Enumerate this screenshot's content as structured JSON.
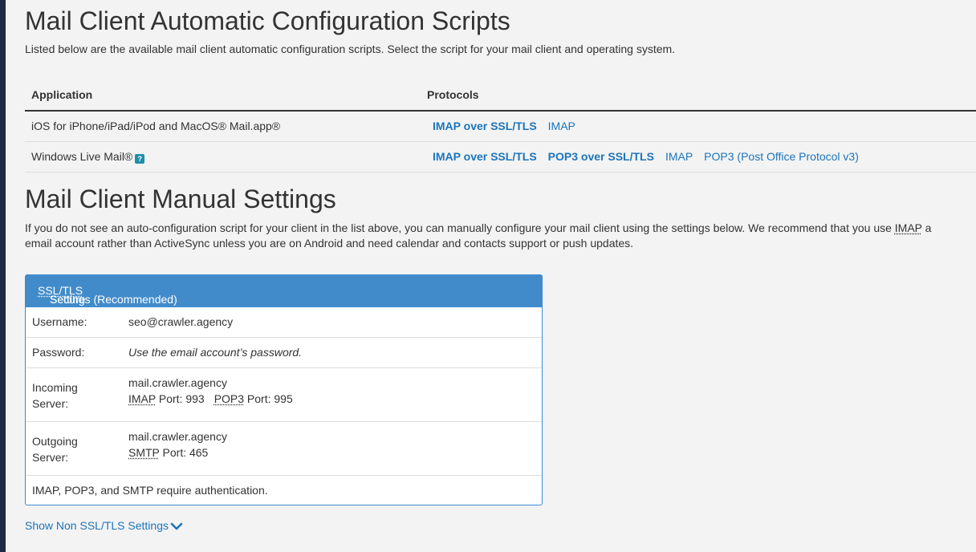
{
  "auto": {
    "title": "Mail Client Automatic Configuration Scripts",
    "intro": "Listed below are the available mail client automatic configuration scripts. Select the script for your mail client and operating system.",
    "columns": {
      "application": "Application",
      "protocols": "Protocols"
    },
    "rows": [
      {
        "app": "iOS for iPhone/iPad/iPod and MacOS® Mail.app®",
        "links": [
          "IMAP over SSL/TLS",
          "IMAP"
        ]
      },
      {
        "app": "Windows Live Mail®",
        "links": [
          "IMAP over SSL/TLS",
          "POP3 over SSL/TLS",
          "IMAP",
          "POP3 (Post Office Protocol v3)"
        ]
      }
    ]
  },
  "manual": {
    "title": "Mail Client Manual Settings",
    "intro_line1_pre": "If you do not see an auto-configuration script for your client in the list above, you can manually configure your mail client using the settings below. We recommend that you use ",
    "intro_line1_abbr": "IMAP",
    "intro_line1_post": " a",
    "intro_line2": "email account rather than ActiveSync unless you are on Android and need calendar and contacts support or push updates."
  },
  "panel": {
    "header_pre": "Secure ",
    "header_abbr": "SSL/TLS",
    "header_post": " Settings (Recommended)",
    "username_label": "Username:",
    "username_value": "seo@crawler.agency",
    "password_label": "Password:",
    "password_value": "Use the email account’s password.",
    "incoming_label_1": "Incoming",
    "incoming_label_2": "Server:",
    "incoming_host": "mail.crawler.agency",
    "incoming_imap": "IMAP",
    "incoming_imap_port": " Port: 993",
    "incoming_pop3": "POP3",
    "incoming_pop3_port": " Port: 995",
    "outgoing_label_1": "Outgoing",
    "outgoing_label_2": "Server:",
    "outgoing_host": "mail.crawler.agency",
    "outgoing_smtp": "SMTP",
    "outgoing_smtp_port": " Port: 465",
    "auth_note": "IMAP, POP3, and SMTP require authentication."
  },
  "toggle_link": "Show Non SSL/TLS Settings",
  "colors": {
    "accent": "#428bca",
    "link": "#1b75bb",
    "edge": "#1e2a44"
  },
  "icons": {
    "help": "help-icon",
    "chevron": "chevron-down-icon"
  }
}
